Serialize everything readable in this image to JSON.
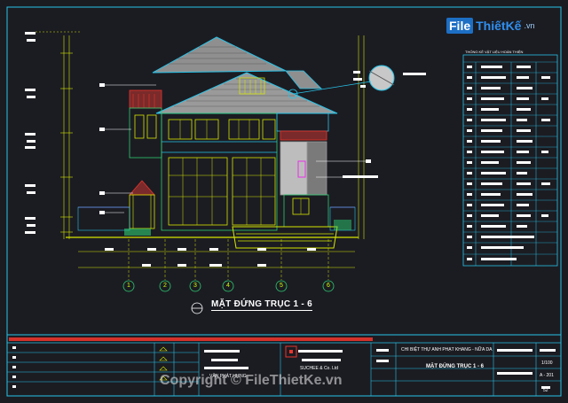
{
  "brand": {
    "box_label": "File",
    "name": "ThiếtKế",
    "suffix": ".vn"
  },
  "drawing": {
    "title": "MẶT ĐỨNG TRỤC 1 - 6",
    "axes": [
      "1",
      "2",
      "3",
      "4",
      "5",
      "6"
    ]
  },
  "title_block": {
    "project": "CHI BIỆT THỰ ANH PHẠT KHANG - NỮA DA",
    "sheet_title": "MẶT ĐỨNG TRỤC 1 - 6",
    "company": "SUCHEE & Co. Ltd",
    "owner_label": "VĂN PHÁT HƯNG",
    "scale": "1/100",
    "sheet_no": "A - 201",
    "page": "52"
  },
  "watermark": "Copyright © FileThietKe.vn",
  "legend_header": "THỐNG KÊ VẬT LIỆU HOÀN THIỆN",
  "colors": {
    "background": "#1b1c22",
    "frame": "#27c3e8",
    "lines": "#d6e600",
    "roof": "#9a9a9a",
    "magenta": "#e62ee6",
    "red": "#e8352c"
  }
}
